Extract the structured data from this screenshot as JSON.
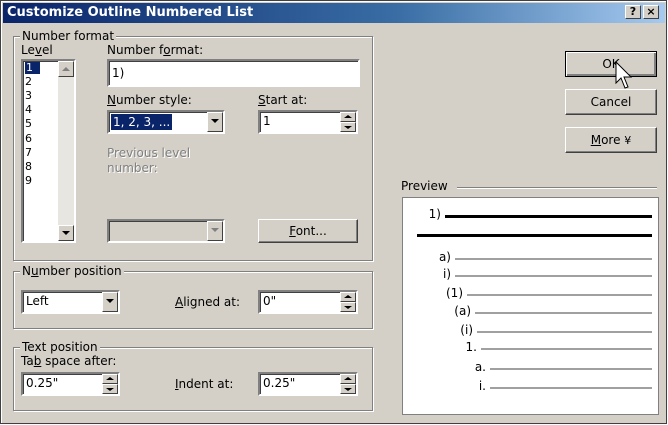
{
  "dialog": {
    "title": "Customize Outline Numbered List",
    "help_label": "?",
    "close_label": "×"
  },
  "number_format_group": {
    "legend": "Number format",
    "level_label_pre": "Le",
    "level_label_key": "v",
    "level_label_post": "el",
    "levels": [
      "1",
      "2",
      "3",
      "4",
      "5",
      "6",
      "7",
      "8",
      "9"
    ],
    "selected_level": "1",
    "number_format_label_pre": "Number f",
    "number_format_label_key": "o",
    "number_format_label_post": "rmat:",
    "number_format_value": "1)",
    "number_style_label_key": "N",
    "number_style_label_post": "umber style:",
    "number_style_value": "1, 2, 3, ...",
    "start_at_label_key": "S",
    "start_at_label_post": "tart at:",
    "start_at_value": "1",
    "previous_level_label": "Previous level number:",
    "font_button_key": "F",
    "font_button_post": "ont..."
  },
  "number_position_group": {
    "legend_pre": "N",
    "legend_key": "u",
    "legend_post": "mber position",
    "alignment_value": "Left",
    "aligned_at_label_key": "A",
    "aligned_at_label_post": "ligned at:",
    "aligned_at_value": "0\""
  },
  "text_position_group": {
    "legend": "Text position",
    "tab_space_label_pre": "Ta",
    "tab_space_label_key": "b",
    "tab_space_label_post": " space after:",
    "tab_space_value": "0.25\"",
    "indent_at_label_key": "I",
    "indent_at_label_post": "ndent at:",
    "indent_at_value": "0.25\""
  },
  "buttons": {
    "ok": "OK",
    "cancel": "Cancel",
    "more_key": "M",
    "more_post": "ore",
    "more_arrow": "¥"
  },
  "preview": {
    "legend": "Preview",
    "items": [
      {
        "label": "1)",
        "bold": true
      },
      {
        "label": "",
        "bold": true
      },
      {
        "label": "a)",
        "bold": false
      },
      {
        "label": "i)",
        "bold": false
      },
      {
        "label": "(1)",
        "bold": false
      },
      {
        "label": "(a)",
        "bold": false
      },
      {
        "label": "(i)",
        "bold": false
      },
      {
        "label": "1.",
        "bold": false
      },
      {
        "label": "a.",
        "bold": false
      },
      {
        "label": "i.",
        "bold": false
      }
    ]
  }
}
